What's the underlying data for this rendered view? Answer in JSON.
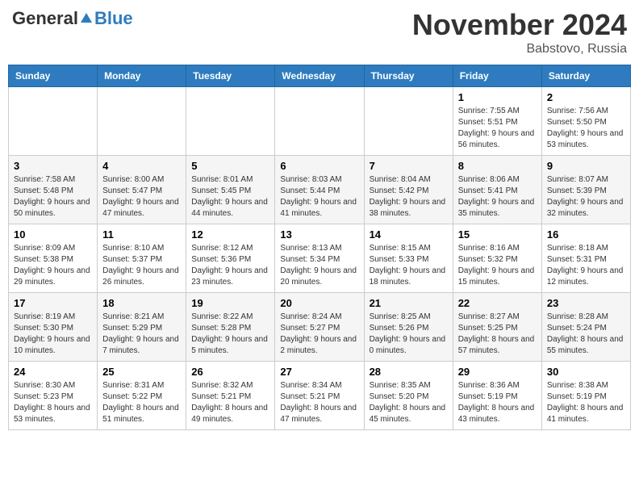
{
  "header": {
    "logo_general": "General",
    "logo_blue": "Blue",
    "month_title": "November 2024",
    "location": "Babstovo, Russia"
  },
  "weekdays": [
    "Sunday",
    "Monday",
    "Tuesday",
    "Wednesday",
    "Thursday",
    "Friday",
    "Saturday"
  ],
  "weeks": [
    [
      {
        "day": "",
        "info": ""
      },
      {
        "day": "",
        "info": ""
      },
      {
        "day": "",
        "info": ""
      },
      {
        "day": "",
        "info": ""
      },
      {
        "day": "",
        "info": ""
      },
      {
        "day": "1",
        "info": "Sunrise: 7:55 AM\nSunset: 5:51 PM\nDaylight: 9 hours and 56 minutes."
      },
      {
        "day": "2",
        "info": "Sunrise: 7:56 AM\nSunset: 5:50 PM\nDaylight: 9 hours and 53 minutes."
      }
    ],
    [
      {
        "day": "3",
        "info": "Sunrise: 7:58 AM\nSunset: 5:48 PM\nDaylight: 9 hours and 50 minutes."
      },
      {
        "day": "4",
        "info": "Sunrise: 8:00 AM\nSunset: 5:47 PM\nDaylight: 9 hours and 47 minutes."
      },
      {
        "day": "5",
        "info": "Sunrise: 8:01 AM\nSunset: 5:45 PM\nDaylight: 9 hours and 44 minutes."
      },
      {
        "day": "6",
        "info": "Sunrise: 8:03 AM\nSunset: 5:44 PM\nDaylight: 9 hours and 41 minutes."
      },
      {
        "day": "7",
        "info": "Sunrise: 8:04 AM\nSunset: 5:42 PM\nDaylight: 9 hours and 38 minutes."
      },
      {
        "day": "8",
        "info": "Sunrise: 8:06 AM\nSunset: 5:41 PM\nDaylight: 9 hours and 35 minutes."
      },
      {
        "day": "9",
        "info": "Sunrise: 8:07 AM\nSunset: 5:39 PM\nDaylight: 9 hours and 32 minutes."
      }
    ],
    [
      {
        "day": "10",
        "info": "Sunrise: 8:09 AM\nSunset: 5:38 PM\nDaylight: 9 hours and 29 minutes."
      },
      {
        "day": "11",
        "info": "Sunrise: 8:10 AM\nSunset: 5:37 PM\nDaylight: 9 hours and 26 minutes."
      },
      {
        "day": "12",
        "info": "Sunrise: 8:12 AM\nSunset: 5:36 PM\nDaylight: 9 hours and 23 minutes."
      },
      {
        "day": "13",
        "info": "Sunrise: 8:13 AM\nSunset: 5:34 PM\nDaylight: 9 hours and 20 minutes."
      },
      {
        "day": "14",
        "info": "Sunrise: 8:15 AM\nSunset: 5:33 PM\nDaylight: 9 hours and 18 minutes."
      },
      {
        "day": "15",
        "info": "Sunrise: 8:16 AM\nSunset: 5:32 PM\nDaylight: 9 hours and 15 minutes."
      },
      {
        "day": "16",
        "info": "Sunrise: 8:18 AM\nSunset: 5:31 PM\nDaylight: 9 hours and 12 minutes."
      }
    ],
    [
      {
        "day": "17",
        "info": "Sunrise: 8:19 AM\nSunset: 5:30 PM\nDaylight: 9 hours and 10 minutes."
      },
      {
        "day": "18",
        "info": "Sunrise: 8:21 AM\nSunset: 5:29 PM\nDaylight: 9 hours and 7 minutes."
      },
      {
        "day": "19",
        "info": "Sunrise: 8:22 AM\nSunset: 5:28 PM\nDaylight: 9 hours and 5 minutes."
      },
      {
        "day": "20",
        "info": "Sunrise: 8:24 AM\nSunset: 5:27 PM\nDaylight: 9 hours and 2 minutes."
      },
      {
        "day": "21",
        "info": "Sunrise: 8:25 AM\nSunset: 5:26 PM\nDaylight: 9 hours and 0 minutes."
      },
      {
        "day": "22",
        "info": "Sunrise: 8:27 AM\nSunset: 5:25 PM\nDaylight: 8 hours and 57 minutes."
      },
      {
        "day": "23",
        "info": "Sunrise: 8:28 AM\nSunset: 5:24 PM\nDaylight: 8 hours and 55 minutes."
      }
    ],
    [
      {
        "day": "24",
        "info": "Sunrise: 8:30 AM\nSunset: 5:23 PM\nDaylight: 8 hours and 53 minutes."
      },
      {
        "day": "25",
        "info": "Sunrise: 8:31 AM\nSunset: 5:22 PM\nDaylight: 8 hours and 51 minutes."
      },
      {
        "day": "26",
        "info": "Sunrise: 8:32 AM\nSunset: 5:21 PM\nDaylight: 8 hours and 49 minutes."
      },
      {
        "day": "27",
        "info": "Sunrise: 8:34 AM\nSunset: 5:21 PM\nDaylight: 8 hours and 47 minutes."
      },
      {
        "day": "28",
        "info": "Sunrise: 8:35 AM\nSunset: 5:20 PM\nDaylight: 8 hours and 45 minutes."
      },
      {
        "day": "29",
        "info": "Sunrise: 8:36 AM\nSunset: 5:19 PM\nDaylight: 8 hours and 43 minutes."
      },
      {
        "day": "30",
        "info": "Sunrise: 8:38 AM\nSunset: 5:19 PM\nDaylight: 8 hours and 41 minutes."
      }
    ]
  ]
}
